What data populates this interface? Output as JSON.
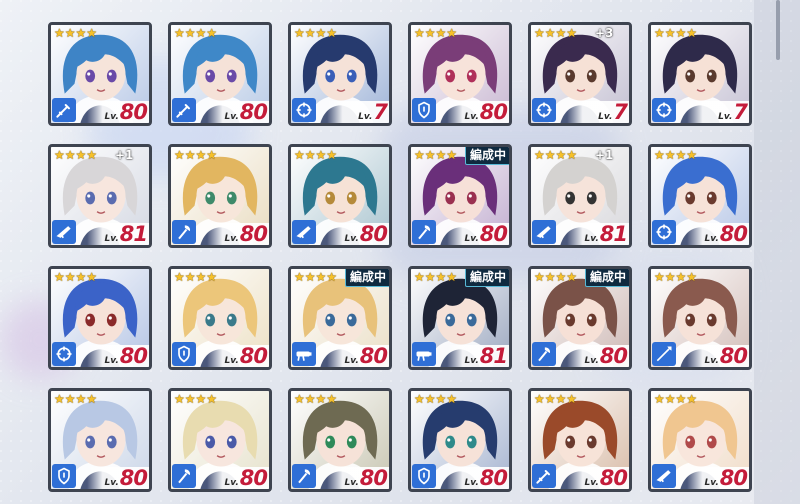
{
  "colors": {
    "star": "#f6c12a",
    "level": "#c41c3a",
    "role_bg": "#2f6fd6",
    "frame": "#3e4450",
    "badge_border": "#58b9d6"
  },
  "level_prefix": "Lv.",
  "rows": [
    [
      {
        "stars": "★★★★",
        "plus": "",
        "badge": "",
        "role": "sword-icon",
        "level": "80",
        "hair": "#3e84c6",
        "eye": "#6a4aa8",
        "face": "#f6e4da",
        "bg": "#b7c8e6"
      },
      {
        "stars": "★★★★",
        "plus": "",
        "badge": "",
        "role": "sword-icon",
        "level": "80",
        "hair": "#3f88c8",
        "eye": "#6a4aa8",
        "face": "#f5e2d8",
        "bg": "#b9cbe6"
      },
      {
        "stars": "★★★★",
        "plus": "",
        "badge": "",
        "role": "crosshair-icon",
        "level": "7",
        "hair": "#263a6e",
        "eye": "#3a5fb8",
        "face": "#f5e2d8",
        "bg": "#9fb4d8"
      },
      {
        "stars": "★★★★",
        "plus": "",
        "badge": "",
        "role": "shield-icon",
        "level": "80",
        "hair": "#7a3d78",
        "eye": "#b0305a",
        "face": "#f7e3da",
        "bg": "#c9b8d2"
      },
      {
        "stars": "★★★★",
        "plus": "+3",
        "badge": "",
        "role": "crosshair-icon",
        "level": "7",
        "hair": "#3a2a4e",
        "eye": "#5a3a2e",
        "face": "#f6e1d6",
        "bg": "#c4c0d2"
      },
      {
        "stars": "★★★★",
        "plus": "",
        "badge": "",
        "role": "crosshair-icon",
        "level": "7",
        "hair": "#2e2a4a",
        "eye": "#5a3a2e",
        "face": "#f6e1d6",
        "bg": "#c6c2d4"
      }
    ],
    [
      {
        "stars": "★★★★",
        "plus": "+1",
        "badge": "",
        "role": "rifle-icon",
        "level": "81",
        "hair": "#d8d6d8",
        "eye": "#5a6cb0",
        "face": "#f7e6de",
        "bg": "#d4d8e2"
      },
      {
        "stars": "★★★★",
        "plus": "",
        "badge": "",
        "role": "axe-icon",
        "level": "80",
        "hair": "#e2b660",
        "eye": "#3e8a6a",
        "face": "#f7e6da",
        "bg": "#e9dcc0"
      },
      {
        "stars": "★★★★",
        "plus": "",
        "badge": "",
        "role": "rifle-icon",
        "level": "80",
        "hair": "#2d7890",
        "eye": "#b58a3a",
        "face": "#f6e2d6",
        "bg": "#a9c4cf"
      },
      {
        "stars": "★★★★",
        "plus": "",
        "badge": "編成中",
        "role": "axe-icon",
        "level": "80",
        "hair": "#6a2f7a",
        "eye": "#9a3050",
        "face": "#f6e0d8",
        "bg": "#c2aed0"
      },
      {
        "stars": "★★★★",
        "plus": "+1",
        "badge": "",
        "role": "rifle-icon",
        "level": "81",
        "hair": "#d4d2d0",
        "eye": "#333333",
        "face": "#f6e3da",
        "bg": "#d8d8dc"
      },
      {
        "stars": "★★★★",
        "plus": "",
        "badge": "",
        "role": "crosshair-icon",
        "level": "80",
        "hair": "#3a6ed0",
        "eye": "#6a3a2e",
        "face": "#f6e2d8",
        "bg": "#b6c6e6"
      }
    ],
    [
      {
        "stars": "★★★★",
        "plus": "",
        "badge": "",
        "role": "crosshair-icon",
        "level": "80",
        "hair": "#3b63c8",
        "eye": "#8a2a2a",
        "face": "#f6e2d8",
        "bg": "#b4c4e4"
      },
      {
        "stars": "★★★★",
        "plus": "",
        "badge": "",
        "role": "shield-icon",
        "level": "80",
        "hair": "#ecc67a",
        "eye": "#3a7a8a",
        "face": "#f7e6da",
        "bg": "#ece0c4"
      },
      {
        "stars": "★★★★",
        "plus": "",
        "badge": "編成中",
        "role": "cannon-icon",
        "level": "80",
        "hair": "#e8c27a",
        "eye": "#3a6a9a",
        "face": "#f7e6da",
        "bg": "#eadfc6"
      },
      {
        "stars": "★★★★",
        "plus": "",
        "badge": "編成中",
        "role": "cannon-icon",
        "level": "81",
        "hair": "#1e2436",
        "eye": "#3a6a9a",
        "face": "#f6e2d8",
        "bg": "#9ca8c0"
      },
      {
        "stars": "★★★★",
        "plus": "",
        "badge": "編成中",
        "role": "axe-icon",
        "level": "80",
        "hair": "#7a5248",
        "eye": "#6a3a2e",
        "face": "#f6e0d6",
        "bg": "#cdb8b4"
      },
      {
        "stars": "★★★★",
        "plus": "",
        "badge": "",
        "role": "spear-icon",
        "level": "80",
        "hair": "#8a5a4e",
        "eye": "#6a3a2e",
        "face": "#f6e2d8",
        "bg": "#d2bdb8"
      }
    ],
    [
      {
        "stars": "★★★★",
        "plus": "",
        "badge": "",
        "role": "shield-icon",
        "level": "80",
        "hair": "#b8c8e4",
        "eye": "#5a6cb0",
        "face": "#f7e6de",
        "bg": "#cbd6e8"
      },
      {
        "stars": "★★★★",
        "plus": "",
        "badge": "",
        "role": "axe-icon",
        "level": "80",
        "hair": "#e8dcb0",
        "eye": "#4a5aa8",
        "face": "#f7e6de",
        "bg": "#e6e2cc"
      },
      {
        "stars": "★★★★",
        "plus": "",
        "badge": "",
        "role": "axe-icon",
        "level": "80",
        "hair": "#6e6a52",
        "eye": "#2e8a5a",
        "face": "#f6e2d8",
        "bg": "#c8c6b2"
      },
      {
        "stars": "★★★★",
        "plus": "",
        "badge": "",
        "role": "shield-icon",
        "level": "80",
        "hair": "#263c6e",
        "eye": "#2e8a8a",
        "face": "#f6e2d8",
        "bg": "#a6b4d0"
      },
      {
        "stars": "★★★★",
        "plus": "",
        "badge": "",
        "role": "sword-icon",
        "level": "80",
        "hair": "#9a4a2a",
        "eye": "#6a3a2e",
        "face": "#f7e3d8",
        "bg": "#d8bca8"
      },
      {
        "stars": "★★★★",
        "plus": "",
        "badge": "",
        "role": "rifle-icon",
        "level": "80",
        "hair": "#f0c690",
        "eye": "#b04a4a",
        "face": "#f8e6dc",
        "bg": "#f0dcc8"
      }
    ]
  ]
}
